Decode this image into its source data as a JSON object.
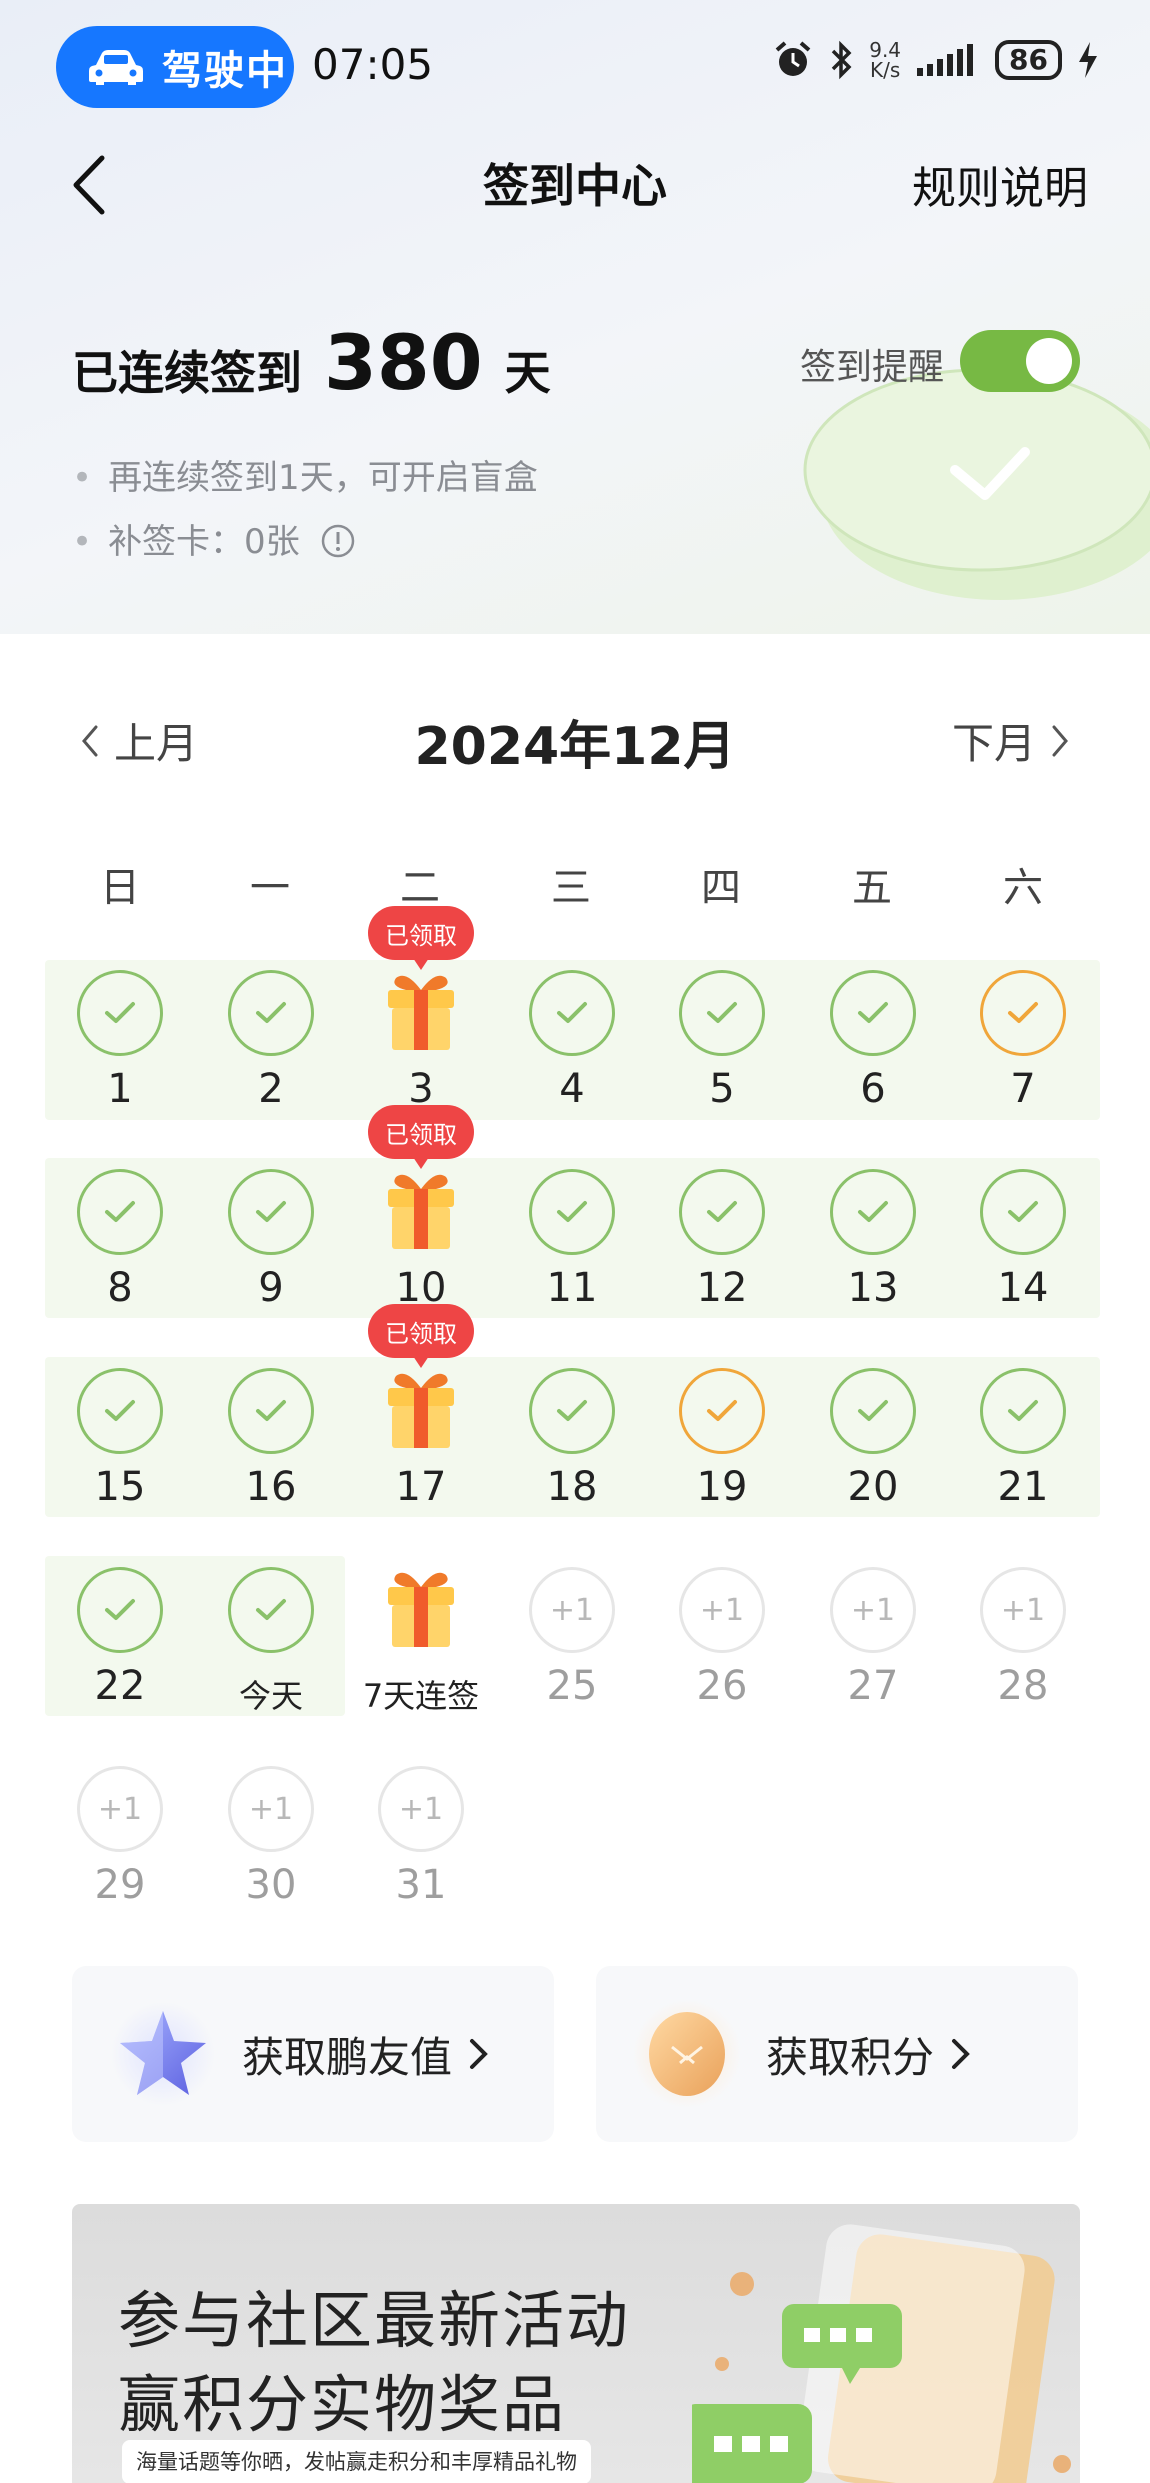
{
  "status_bar": {
    "driving_label": "驾驶中",
    "time": "07:05",
    "speed_value": "9.4",
    "speed_unit": "K/s",
    "battery": "86"
  },
  "nav": {
    "title": "签到中心",
    "rules_label": "规则说明"
  },
  "summary": {
    "streak_prefix": "已连续签到",
    "streak_days": "380",
    "streak_suffix": "天",
    "reminder_label": "签到提醒",
    "reminder_on": true,
    "hint_blind_box": "再连续签到1天，可开启盲盒",
    "hint_makeup_card": "补签卡：0张"
  },
  "calendar": {
    "prev_label": "上月",
    "next_label": "下月",
    "month_title": "2024年12月",
    "weekdays": [
      "日",
      "一",
      "二",
      "三",
      "四",
      "五",
      "六"
    ],
    "claimed_label": "已领取",
    "plus_one": "+1",
    "days": [
      {
        "label": "1",
        "state": "checked"
      },
      {
        "label": "2",
        "state": "checked"
      },
      {
        "label": "3",
        "state": "gift-claimed"
      },
      {
        "label": "4",
        "state": "checked"
      },
      {
        "label": "5",
        "state": "checked"
      },
      {
        "label": "6",
        "state": "checked"
      },
      {
        "label": "7",
        "state": "makeup"
      },
      {
        "label": "8",
        "state": "checked"
      },
      {
        "label": "9",
        "state": "checked"
      },
      {
        "label": "10",
        "state": "gift-claimed"
      },
      {
        "label": "11",
        "state": "checked"
      },
      {
        "label": "12",
        "state": "checked"
      },
      {
        "label": "13",
        "state": "checked"
      },
      {
        "label": "14",
        "state": "checked"
      },
      {
        "label": "15",
        "state": "checked"
      },
      {
        "label": "16",
        "state": "checked"
      },
      {
        "label": "17",
        "state": "gift-claimed"
      },
      {
        "label": "18",
        "state": "checked"
      },
      {
        "label": "19",
        "state": "makeup"
      },
      {
        "label": "20",
        "state": "checked"
      },
      {
        "label": "21",
        "state": "checked"
      },
      {
        "label": "22",
        "state": "checked"
      },
      {
        "label": "今天",
        "state": "checked"
      },
      {
        "label": "7天连签",
        "state": "gift"
      },
      {
        "label": "25",
        "state": "future"
      },
      {
        "label": "26",
        "state": "future"
      },
      {
        "label": "27",
        "state": "future"
      },
      {
        "label": "28",
        "state": "future"
      },
      {
        "label": "29",
        "state": "future"
      },
      {
        "label": "30",
        "state": "future"
      },
      {
        "label": "31",
        "state": "future"
      }
    ]
  },
  "cards": {
    "friend_value": "获取鹏友值",
    "points": "获取积分"
  },
  "banner": {
    "line1": "参与社区最新活动",
    "line2": "赢积分实物奖品",
    "subtitle": "海量话题等你晒，发帖赢走积分和丰厚精品礼物"
  },
  "colors": {
    "accent_blue": "#1677ff",
    "check_green": "#8ac16a",
    "makeup_orange": "#f0a63a",
    "claimed_red": "#ee4545",
    "toggle_green": "#77b944"
  }
}
